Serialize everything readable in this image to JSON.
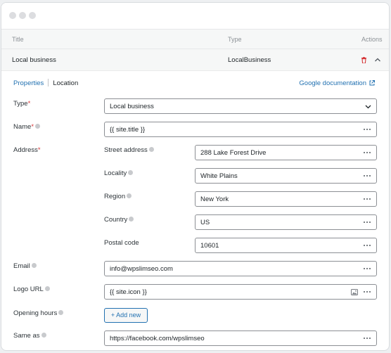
{
  "window": {
    "controls": [
      "close",
      "minimize",
      "maximize"
    ]
  },
  "table": {
    "headers": {
      "title": "Title",
      "type": "Type",
      "actions": "Actions"
    },
    "row": {
      "title": "Local business",
      "type": "LocalBusiness"
    }
  },
  "tabs": {
    "properties": "Properties",
    "location": "Location"
  },
  "doc_link": "Google documentation",
  "form": {
    "type": {
      "label": "Type",
      "required": "*",
      "value": "Local business"
    },
    "name": {
      "label": "Name",
      "required": "*",
      "value": "{{ site.title }}"
    },
    "address": {
      "label": "Address",
      "required": "*",
      "street": {
        "label": "Street address",
        "value": "288 Lake Forest Drive"
      },
      "locality": {
        "label": "Locality",
        "value": "White Plains"
      },
      "region": {
        "label": "Region",
        "value": "New York"
      },
      "country": {
        "label": "Country",
        "value": "US"
      },
      "postal": {
        "label": "Postal code",
        "value": "10601"
      }
    },
    "email": {
      "label": "Email",
      "value": "info@wpslimseo.com"
    },
    "logo": {
      "label": "Logo URL",
      "value": "{{ site.icon }}"
    },
    "hours": {
      "label": "Opening hours",
      "button": "+ Add new"
    },
    "same_as": {
      "label": "Same as",
      "value": "https://facebook.com/wpslimseo"
    }
  },
  "colors": {
    "accent": "#2271b1",
    "required": "#d63638",
    "border": "#8c8f94"
  }
}
